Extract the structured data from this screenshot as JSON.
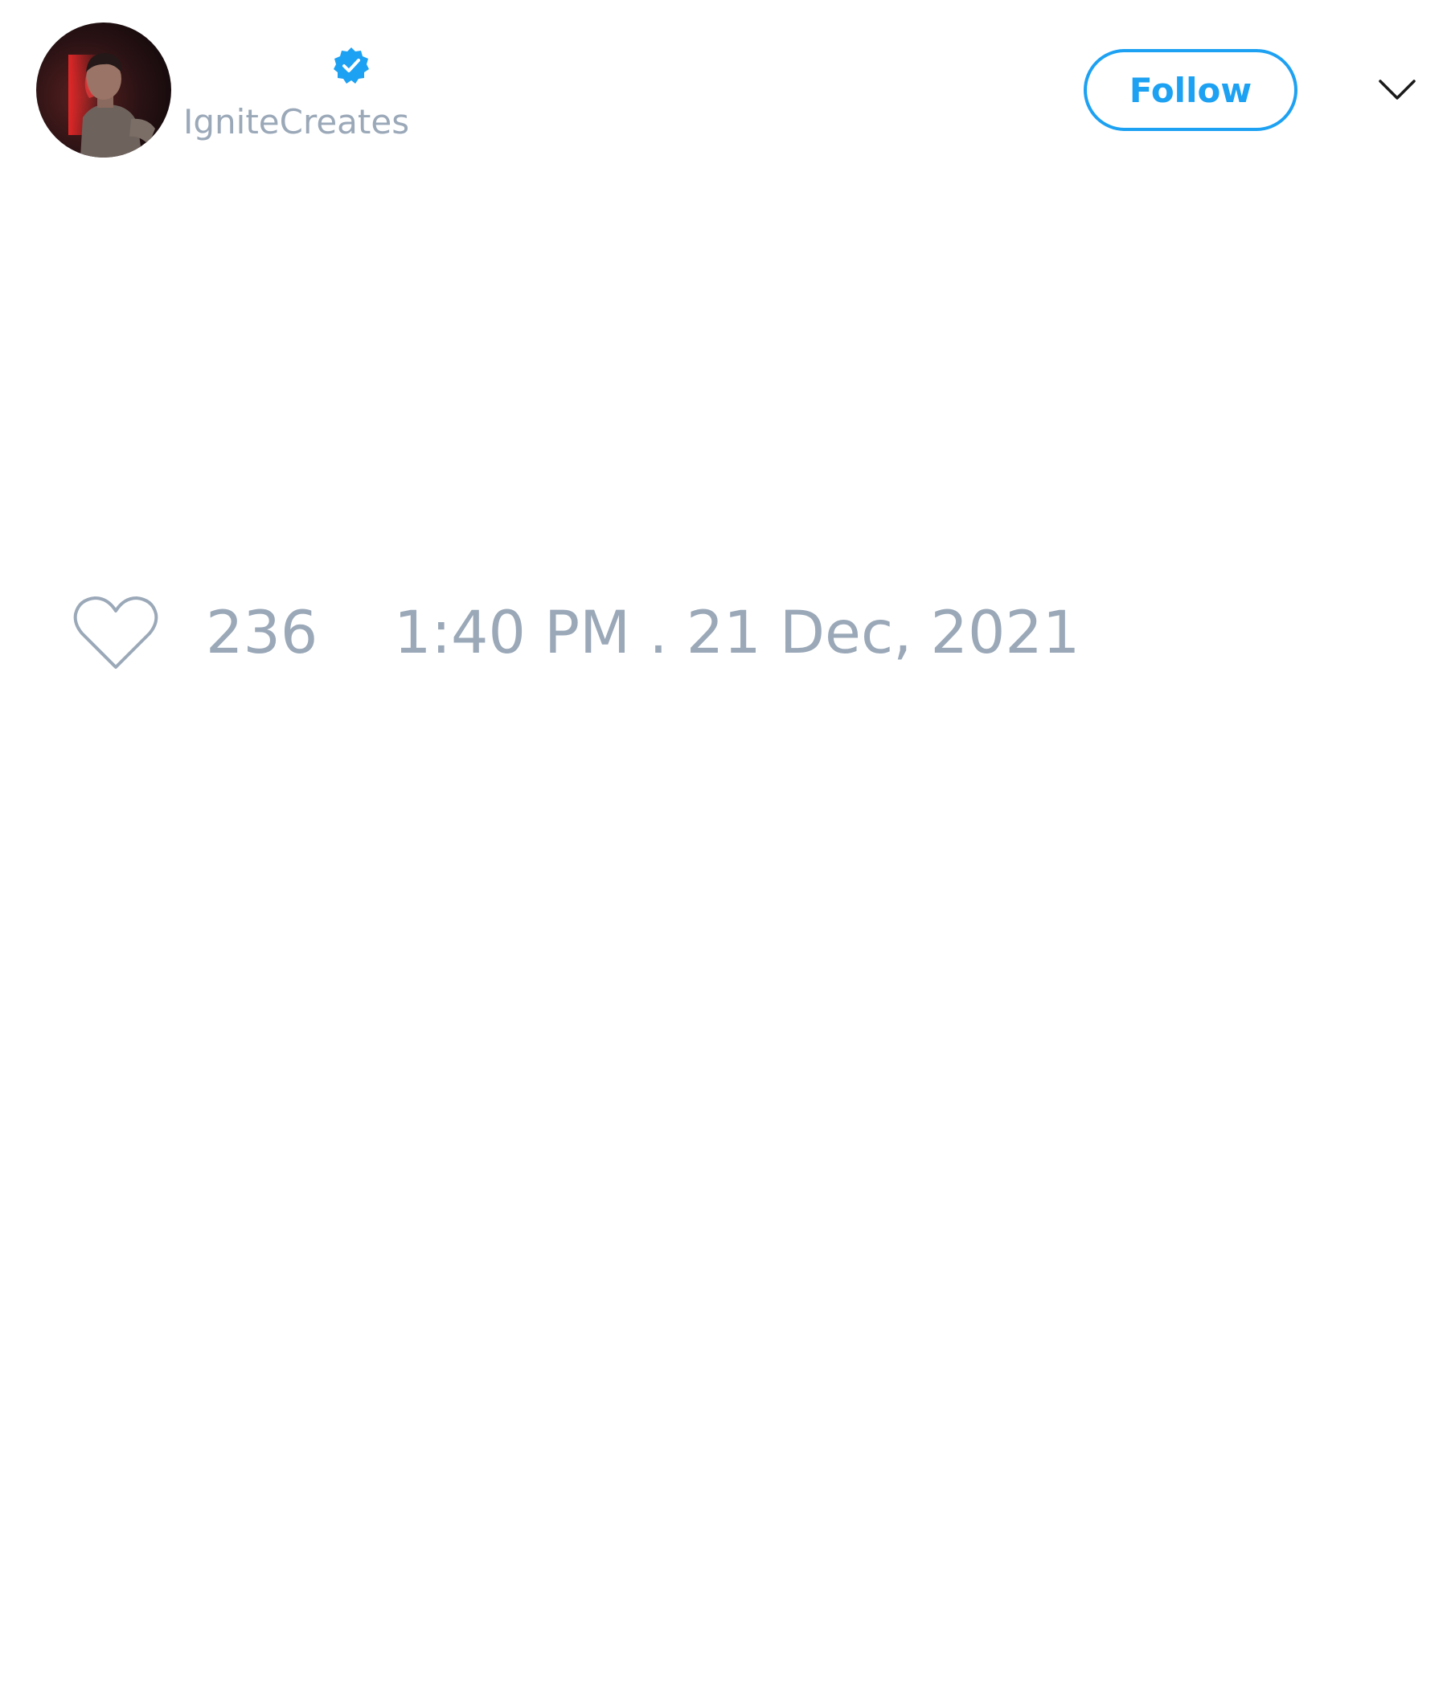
{
  "tweet": {
    "author": {
      "handle": "IgniteCreates",
      "verified": true
    },
    "follow_label": "Follow",
    "likes": "236",
    "timestamp": "1:40 PM . 21 Dec, 2021"
  },
  "icons": {
    "avatar": "avatar-photo",
    "verified": "verified-badge-icon",
    "more": "chevron-down-icon",
    "like": "heart-outline-icon"
  },
  "colors": {
    "accent": "#1da1f2",
    "muted_text": "#9aa8b8",
    "icon_dark": "#1a1a1a",
    "background": "#ffffff"
  }
}
